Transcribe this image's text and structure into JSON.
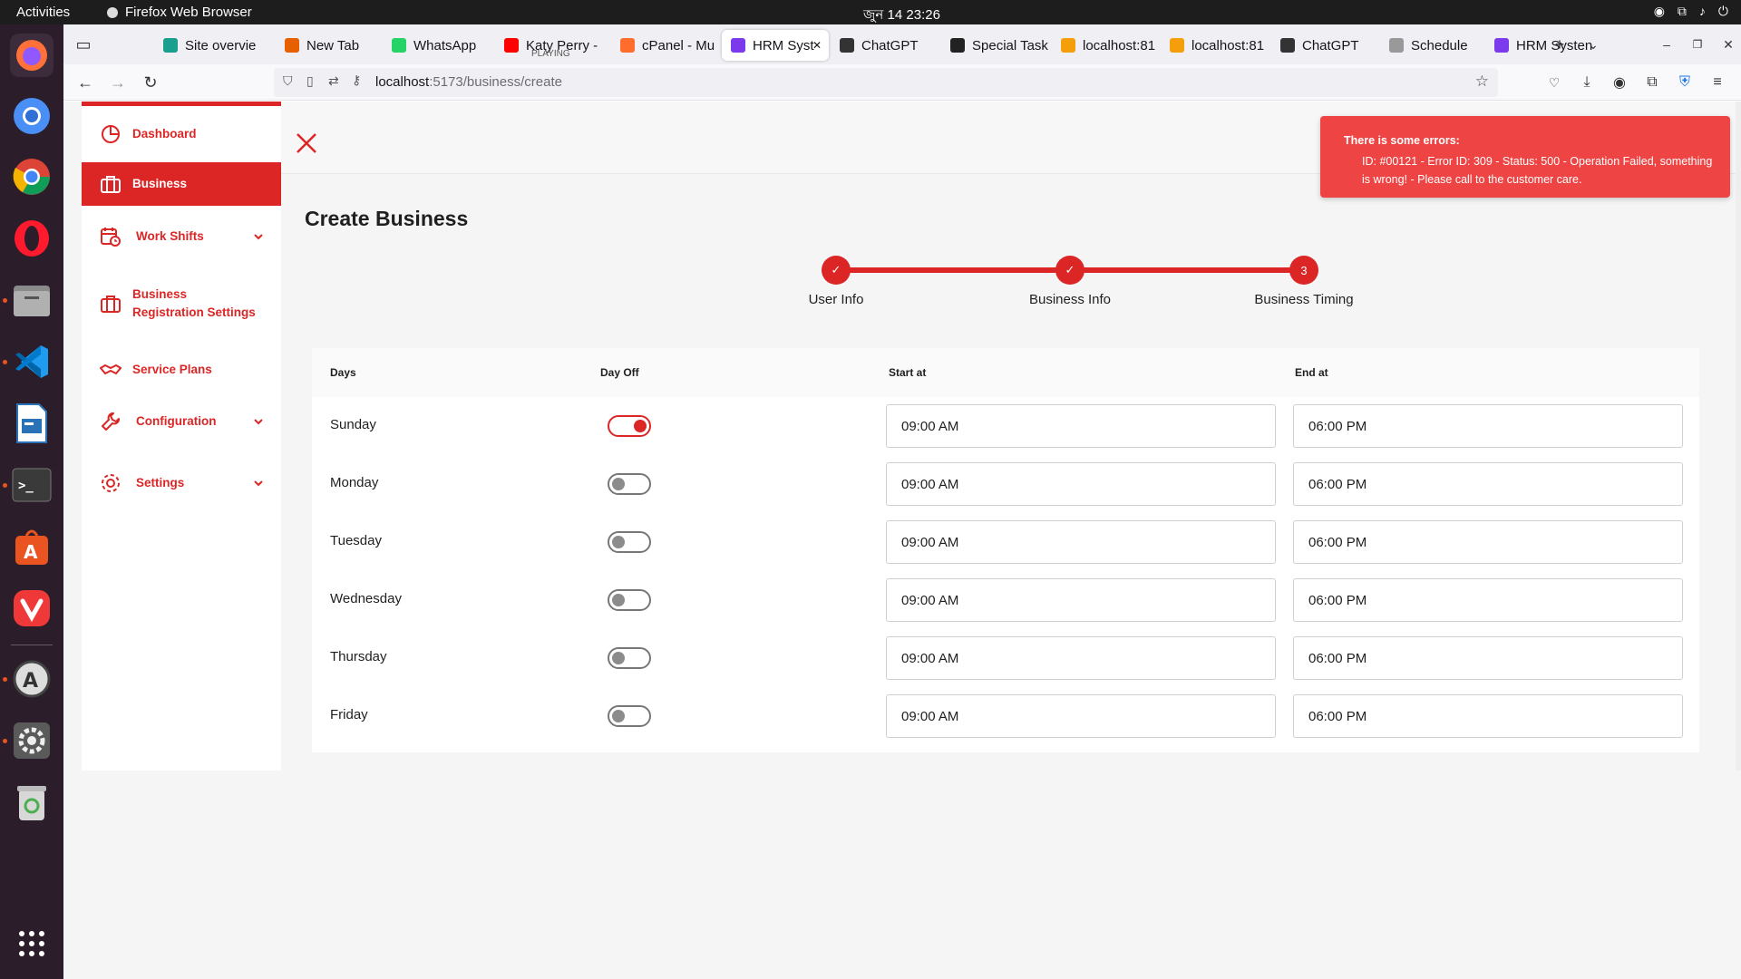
{
  "system": {
    "activities": "Activities",
    "app_name": "Firefox Web Browser",
    "clock": "জুন 14  23:26"
  },
  "browser": {
    "tabs": [
      {
        "label": "Site overvie",
        "color": "#1a9e8e"
      },
      {
        "label": "New Tab",
        "color": "#e66000"
      },
      {
        "label": "WhatsApp",
        "color": "#25d366"
      },
      {
        "label": "Katy Perry -",
        "sub": "PLAYING",
        "color": "#ff0000"
      },
      {
        "label": "cPanel - Mu",
        "color": "#ff6c2c"
      },
      {
        "label": "HRM Syst",
        "color": "#7c3aed"
      },
      {
        "label": "ChatGPT",
        "color": "#333333"
      },
      {
        "label": "Special Task",
        "color": "#222222"
      },
      {
        "label": "localhost:81",
        "color": "#f59e0b"
      },
      {
        "label": "localhost:81",
        "color": "#f59e0b"
      },
      {
        "label": "ChatGPT",
        "color": "#333333"
      },
      {
        "label": "Schedule",
        "color": "#999999"
      },
      {
        "label": "HRM Systen",
        "color": "#7c3aed"
      }
    ],
    "url_host": "localhost",
    "url_path": ":5173/business/create"
  },
  "sidebar": {
    "items": [
      {
        "label": "Dashboard"
      },
      {
        "label": "Business"
      },
      {
        "label": "Work Shifts"
      },
      {
        "label": "Business Registration Settings"
      },
      {
        "label": "Service Plans"
      },
      {
        "label": "Configuration"
      },
      {
        "label": "Settings"
      }
    ]
  },
  "page": {
    "title": "Create Business"
  },
  "stepper": {
    "steps": [
      {
        "label": "User Info",
        "marker": "✓"
      },
      {
        "label": "Business Info",
        "marker": "✓"
      },
      {
        "label": "Business Timing",
        "marker": "3"
      }
    ]
  },
  "table": {
    "headers": {
      "days": "Days",
      "day_off": "Day Off",
      "start": "Start at",
      "end": "End at"
    },
    "rows": [
      {
        "day": "Sunday",
        "day_off": true,
        "start": "09:00 AM",
        "end": "06:00 PM"
      },
      {
        "day": "Monday",
        "day_off": false,
        "start": "09:00 AM",
        "end": "06:00 PM"
      },
      {
        "day": "Tuesday",
        "day_off": false,
        "start": "09:00 AM",
        "end": "06:00 PM"
      },
      {
        "day": "Wednesday",
        "day_off": false,
        "start": "09:00 AM",
        "end": "06:00 PM"
      },
      {
        "day": "Thursday",
        "day_off": false,
        "start": "09:00 AM",
        "end": "06:00 PM"
      },
      {
        "day": "Friday",
        "day_off": false,
        "start": "09:00 AM",
        "end": "06:00 PM"
      }
    ]
  },
  "toast": {
    "heading": "There is some errors:",
    "message": "ID: #00121 - Error ID: 309 - Status: 500 - Operation Failed, something is wrong! - Please call to the customer care."
  },
  "colors": {
    "accent": "#dc2626",
    "error": "#ef4444"
  }
}
